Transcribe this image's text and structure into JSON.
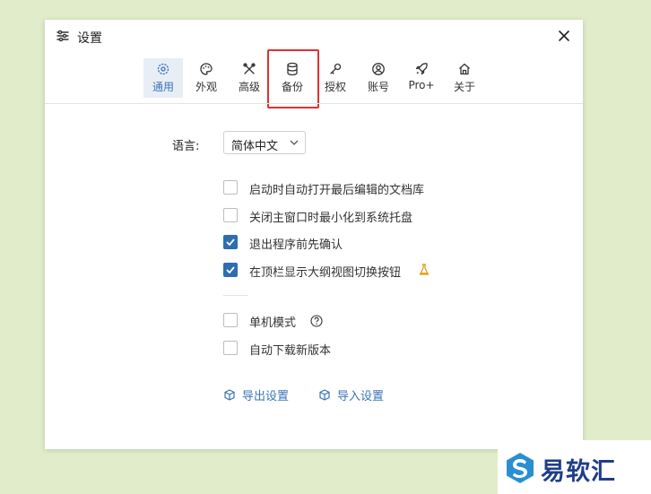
{
  "dialog": {
    "title": "设置",
    "close_icon": "close-icon",
    "title_icon": "sliders-icon"
  },
  "tabs": [
    {
      "label": "通用",
      "icon": "gear-icon",
      "active": true
    },
    {
      "label": "外观",
      "icon": "palette-icon",
      "active": false
    },
    {
      "label": "高级",
      "icon": "tools-icon",
      "active": false
    },
    {
      "label": "备份",
      "icon": "database-icon",
      "active": false,
      "highlighted": true
    },
    {
      "label": "授权",
      "icon": "key-icon",
      "active": false
    },
    {
      "label": "账号",
      "icon": "user-circle-icon",
      "active": false
    },
    {
      "label": "Pro+",
      "icon": "rocket-icon",
      "active": false
    },
    {
      "label": "关于",
      "icon": "home-icon",
      "active": false
    }
  ],
  "language": {
    "label": "语言:",
    "value": "简体中文"
  },
  "options": [
    {
      "label": "启动时自动打开最后编辑的文档库",
      "checked": false
    },
    {
      "label": "关闭主窗口时最小化到系统托盘",
      "checked": false
    },
    {
      "label": "退出程序前先确认",
      "checked": true
    },
    {
      "label": "在顶栏显示大纲视图切换按钮",
      "checked": true,
      "badge_icon": "flask-icon"
    }
  ],
  "options2": [
    {
      "label": "单机模式",
      "checked": false,
      "help_icon": "question-circle-icon"
    },
    {
      "label": "自动下载新版本",
      "checked": false
    }
  ],
  "actions": {
    "export_label": "导出设置",
    "import_label": "导入设置"
  },
  "watermark": {
    "text": "易软汇"
  },
  "colors": {
    "accent": "#2f6db0",
    "link": "#3a74b8",
    "highlight": "#e03131",
    "background": "#e1ecca"
  }
}
